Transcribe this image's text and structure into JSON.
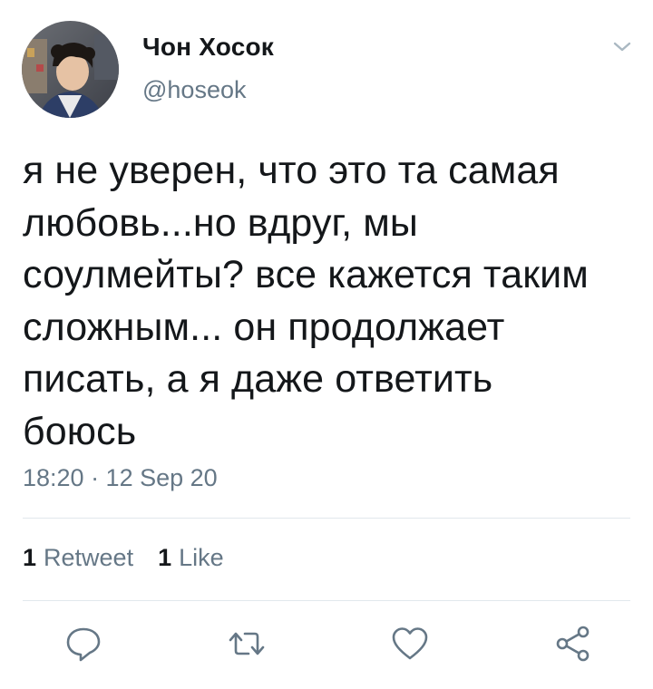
{
  "tweet": {
    "author": {
      "display_name": "Чон Хосок",
      "handle": "@hoseok"
    },
    "text": "я не уверен, что это та самая\nлюбовь...но вдруг, мы\nсоулмейты? все кажется таким\nсложным... он продолжает\nписать, а я даже ответить\nбоюсь",
    "timestamp": "18:20 · 12 Sep 20",
    "stats": {
      "retweets_count": "1",
      "retweets_label": "Retweet",
      "likes_count": "1",
      "likes_label": "Like"
    }
  },
  "colors": {
    "text_primary": "#14171a",
    "text_secondary": "#657786",
    "divider": "#e1e8ed",
    "icon": "#657786"
  },
  "icons": {
    "more": "chevron-down-icon",
    "reply": "reply-icon",
    "retweet": "retweet-icon",
    "like": "heart-icon",
    "share": "share-icon"
  }
}
